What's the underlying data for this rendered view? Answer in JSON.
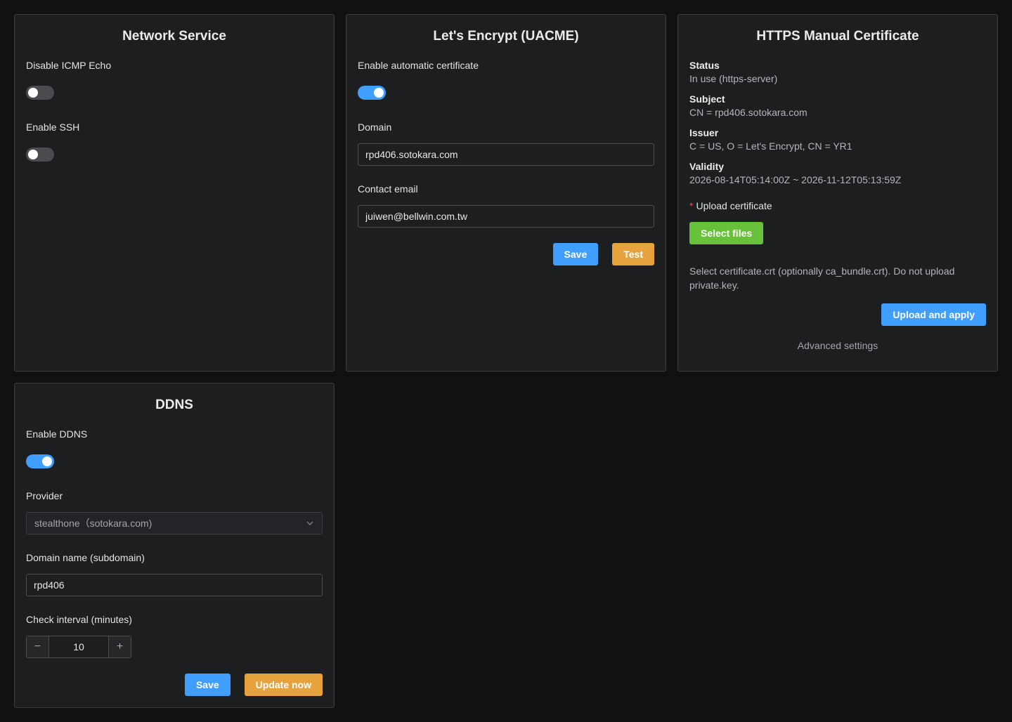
{
  "network_service": {
    "title": "Network Service",
    "icmp_label": "Disable ICMP Echo",
    "icmp_enabled": false,
    "ssh_label": "Enable SSH",
    "ssh_enabled": false
  },
  "letsencrypt": {
    "title": "Let's Encrypt (UACME)",
    "auto_cert_label": "Enable automatic certificate",
    "auto_cert_enabled": true,
    "domain_label": "Domain",
    "domain_value": "rpd406.sotokara.com",
    "email_label": "Contact email",
    "email_value": "juiwen@bellwin.com.tw",
    "save_label": "Save",
    "test_label": "Test"
  },
  "https_manual": {
    "title": "HTTPS Manual Certificate",
    "status_key": "Status",
    "status_value": "In use (https-server)",
    "subject_key": "Subject",
    "subject_value": "CN = rpd406.sotokara.com",
    "issuer_key": "Issuer",
    "issuer_value": "C = US, O = Let's Encrypt, CN = YR1",
    "validity_key": "Validity",
    "validity_value": "2026-08-14T05:14:00Z ~ 2026-11-12T05:13:59Z",
    "required_mark": "*",
    "upload_label": "Upload certificate",
    "select_files_label": "Select files",
    "hint": "Select certificate.crt (optionally ca_bundle.crt). Do not upload private.key.",
    "upload_apply_label": "Upload and apply",
    "advanced_label": "Advanced settings"
  },
  "ddns": {
    "title": "DDNS",
    "enable_label": "Enable DDNS",
    "enabled": true,
    "provider_label": "Provider",
    "provider_value": "stealthone（sotokara.com)",
    "subdomain_label": "Domain name (subdomain)",
    "subdomain_value": "rpd406",
    "interval_label": "Check interval (minutes)",
    "interval_value": "10",
    "minus_symbol": "−",
    "plus_symbol": "+",
    "save_label": "Save",
    "update_label": "Update now"
  },
  "colors": {
    "page_bg": "#111111",
    "card_bg": "#1d1e20",
    "primary": "#409eff",
    "warning": "#e6a23c",
    "success": "#67c23a",
    "danger": "#e05656"
  },
  "icons": {
    "provider_dropdown": "chevron-down-icon"
  }
}
